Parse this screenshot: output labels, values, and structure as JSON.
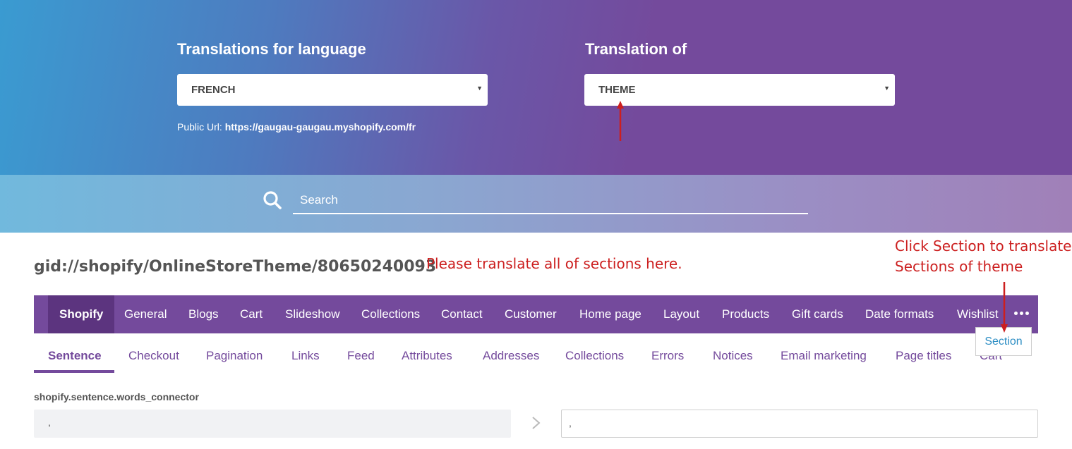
{
  "header": {
    "language_label": "Translations for language",
    "language_value": "FRENCH",
    "translation_of_label": "Translation of",
    "translation_of_value": "THEME",
    "public_url_label": "Public Url:",
    "public_url_value": "https://gaugau-gaugau.myshopify.com/fr"
  },
  "search": {
    "placeholder": "Search"
  },
  "theme_id": "gid://shopify/OnlineStoreTheme/80650240093",
  "annotations": {
    "translate_all": "Please translate all of sections here.",
    "click_section_line1": "Click Section to translate",
    "click_section_line2": "Sections of theme"
  },
  "primary_nav": {
    "items": [
      "Shopify",
      "General",
      "Blogs",
      "Cart",
      "Slideshow",
      "Collections",
      "Contact",
      "Customer",
      "Home page",
      "Layout",
      "Products",
      "Gift cards",
      "Date formats",
      "Wishlist"
    ],
    "active": "Shopify",
    "overflow_item": "Section"
  },
  "secondary_nav": {
    "items": [
      "Sentence",
      "Checkout",
      "Pagination",
      "Links",
      "Feed",
      "Attributes",
      "Addresses",
      "Collections",
      "Errors",
      "Notices",
      "Email marketing",
      "Page titles",
      "Cart"
    ],
    "active": "Sentence"
  },
  "field": {
    "key": "shopify.sentence.words_connector",
    "source_value": ",",
    "target_value": ","
  },
  "colors": {
    "accent": "#744a9c",
    "accent_dark": "#5c347f",
    "annotation_red": "#cc1f1f",
    "link_blue": "#2d8ec4"
  }
}
